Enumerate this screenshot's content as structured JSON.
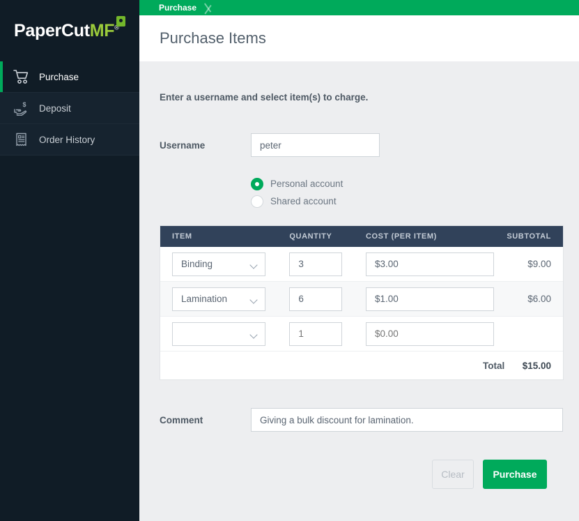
{
  "sidebar": {
    "logo": {
      "part1": "PaperCut",
      "part2": "MF",
      "trademark": "®"
    },
    "items": [
      {
        "label": "Purchase",
        "icon": "shopping-cart-icon",
        "active": true
      },
      {
        "label": "Deposit",
        "icon": "hand-dollar-icon",
        "active": false
      },
      {
        "label": "Order History",
        "icon": "receipt-icon",
        "active": false
      }
    ]
  },
  "breadcrumb": {
    "crumb": "Purchase"
  },
  "header": {
    "title": "Purchase Items"
  },
  "main": {
    "intro": "Enter a username and select item(s) to charge.",
    "username": {
      "label": "Username",
      "value": "peter",
      "placeholder": ""
    },
    "account_type": {
      "options": [
        {
          "label": "Personal account",
          "selected": true
        },
        {
          "label": "Shared account",
          "selected": false
        }
      ]
    },
    "table": {
      "headers": {
        "item": "ITEM",
        "quantity": "QUANTITY",
        "cost": "COST (PER ITEM)",
        "subtotal": "SUBTOTAL"
      },
      "rows": [
        {
          "item": "Binding",
          "quantity": "3",
          "cost": "$3.00",
          "subtotal": "$9.00",
          "empty": false
        },
        {
          "item": "Lamination",
          "quantity": "6",
          "cost": "$1.00",
          "subtotal": "$6.00",
          "empty": false
        },
        {
          "item": "",
          "quantity": "1",
          "cost": "$0.00",
          "subtotal": "",
          "empty": true
        }
      ],
      "total_label": "Total",
      "total_value": "$15.00"
    },
    "comment": {
      "label": "Comment",
      "value": "Giving a bulk discount for lamination.",
      "placeholder": ""
    },
    "buttons": {
      "clear": "Clear",
      "purchase": "Purchase"
    }
  },
  "colors": {
    "brand_green": "#00AA5B",
    "sidebar_dark": "#101C26",
    "sidebar_row": "#16232F",
    "table_header": "#31425A",
    "page_bg": "#EDEEF0"
  }
}
